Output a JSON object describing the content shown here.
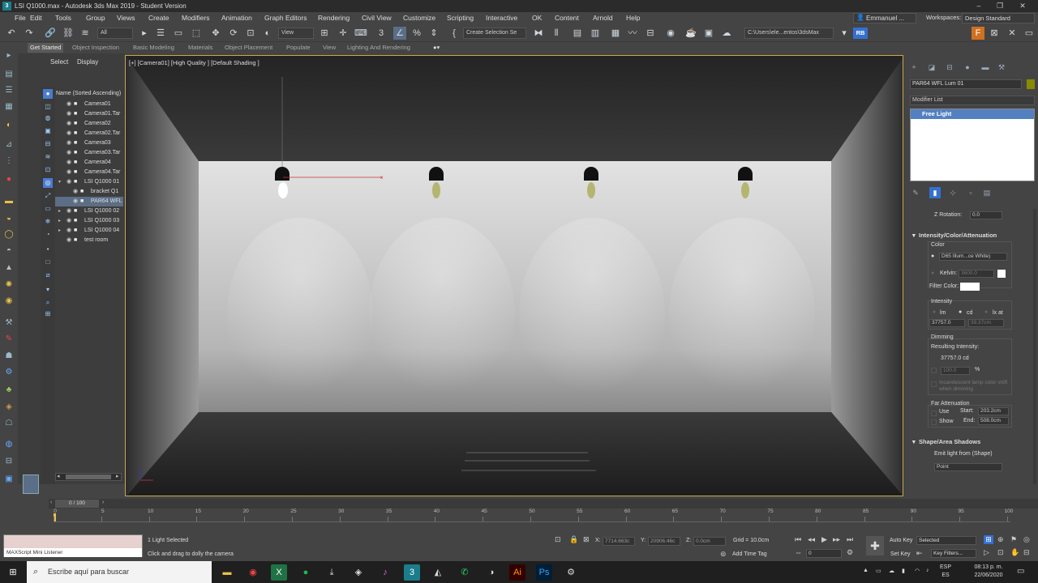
{
  "window": {
    "title": "LSI Q1000.max - Autodesk 3ds Max 2019 - Student Version",
    "controls": [
      "–",
      "❐",
      "✕"
    ]
  },
  "menubar": {
    "items": [
      "File",
      "Edit",
      "Tools",
      "Group",
      "Views",
      "Create",
      "Modifiers",
      "Animation",
      "Graph Editors",
      "Rendering",
      "Civil View",
      "Customize",
      "Scripting",
      "Interactive",
      "OK",
      "Content",
      "Arnold",
      "Help"
    ],
    "user": "Emmanuel ...",
    "workspaces_label": "Workspaces:",
    "workspace_value": "Design Standard"
  },
  "toolbar": {
    "filter_value": "All",
    "view_value": "View",
    "selection_set_placeholder": "Create Selection Se",
    "path_value": "C:\\Users\\ele...entos\\3dsMax",
    "rb_label": "RB"
  },
  "ribbon": {
    "tabs": [
      "Get Started",
      "Object Inspection",
      "Basic Modeling",
      "Materials",
      "Object Placement",
      "Populate",
      "View",
      "Lighting And Rendering"
    ]
  },
  "explorer": {
    "tabs": [
      "Select",
      "Display"
    ],
    "header": "Name (Sorted Ascending)",
    "rows": [
      {
        "label": "Camera01",
        "level": 0,
        "expander": "",
        "selected": false
      },
      {
        "label": "Camera01.Tar",
        "level": 0,
        "expander": "",
        "selected": false
      },
      {
        "label": "Camera02",
        "level": 0,
        "expander": "",
        "selected": false
      },
      {
        "label": "Camera02.Tar",
        "level": 0,
        "expander": "",
        "selected": false
      },
      {
        "label": "Camera03",
        "level": 0,
        "expander": "",
        "selected": false
      },
      {
        "label": "Camera03.Tar",
        "level": 0,
        "expander": "",
        "selected": false
      },
      {
        "label": "Camera04",
        "level": 0,
        "expander": "",
        "selected": false
      },
      {
        "label": "Camera04.Tar",
        "level": 0,
        "expander": "",
        "selected": false
      },
      {
        "label": "LSI Q1000 01",
        "level": 0,
        "expander": "▾",
        "selected": false
      },
      {
        "label": "bracket Q1",
        "level": 1,
        "expander": "",
        "selected": false
      },
      {
        "label": "PAR64 WFL",
        "level": 1,
        "expander": "",
        "selected": true
      },
      {
        "label": "LSI Q1000 02",
        "level": 0,
        "expander": "▸",
        "selected": false
      },
      {
        "label": "LSI Q1000 03",
        "level": 0,
        "expander": "▸",
        "selected": false
      },
      {
        "label": "LSI Q1000 04",
        "level": 0,
        "expander": "▸",
        "selected": false
      },
      {
        "label": "test room",
        "level": 0,
        "expander": "",
        "selected": false
      }
    ]
  },
  "viewport": {
    "label": "[+] [Camera01] [High Quality ] [Default Shading ]",
    "fixtures": 4,
    "selected_fixture": 1
  },
  "command_panel": {
    "object_name": "PAR64 WFL Lum 01",
    "object_color": "#8a8a00",
    "modifier_list_label": "Modifier List",
    "stack_item": "Free Light",
    "z_rotation_label": "Z Rotation:",
    "z_rotation_value": "0.0",
    "section_intensity": "Intensity/Color/Attenuation",
    "color_label": "Color",
    "color_preset": "D65 Illum...ce White)",
    "kelvin_label": "Kelvin:",
    "kelvin_value": "3600.0",
    "filter_color_label": "Filter Color:",
    "intensity_label": "Intensity",
    "unit_lm": "lm",
    "unit_cd": "cd",
    "unit_lx": "lx at",
    "intensity_value": "37757.0",
    "lx_distance": "39.37cm",
    "dimming_label": "Dimming",
    "resulting_label": "Resulting Intensity:",
    "resulting_value": "37757.0 cd",
    "dim_percent": "100.0",
    "percent_sign": "%",
    "incandescent_note": "Incandescent lamp color shift when dimming",
    "far_atten_label": "Far Attenuation",
    "use_label": "Use",
    "show_label": "Show",
    "start_label": "Start:",
    "start_value": "203.2cm",
    "end_label": "End:",
    "end_value": "508.0cm",
    "section_shadows": "Shape/Area Shadows",
    "emit_label": "Emit light from (Shape)",
    "shape_value": "Point"
  },
  "timeline": {
    "frame_display": "0 / 100",
    "ticks": [
      "0",
      "5",
      "10",
      "15",
      "20",
      "25",
      "30",
      "35",
      "40",
      "45",
      "50",
      "55",
      "60",
      "65",
      "70",
      "75",
      "80",
      "85",
      "90",
      "95",
      "100"
    ]
  },
  "status": {
    "maxscript_label": "MAXScript Mini Listener",
    "selection_text": "1 Light Selected",
    "prompt_text": "Click and drag to dolly the camera",
    "x_label": "X:",
    "x_value": "7714.663c",
    "y_label": "Y:",
    "y_value": "20906.46c",
    "z_label": "Z:",
    "z_value": "0.0cm",
    "grid_text": "Grid = 10.0cm",
    "time_tag": "Add Time Tag",
    "frame_value": "0",
    "auto_key": "Auto Key",
    "set_key": "Set Key",
    "selected_dd": "Selected",
    "key_filters": "Key Filters..."
  },
  "taskbar": {
    "search_placeholder": "Escribe aquí para buscar",
    "lang_top": "ESP",
    "lang_bottom": "ES",
    "time": "08:13 p. m.",
    "date": "22/06/2020"
  }
}
